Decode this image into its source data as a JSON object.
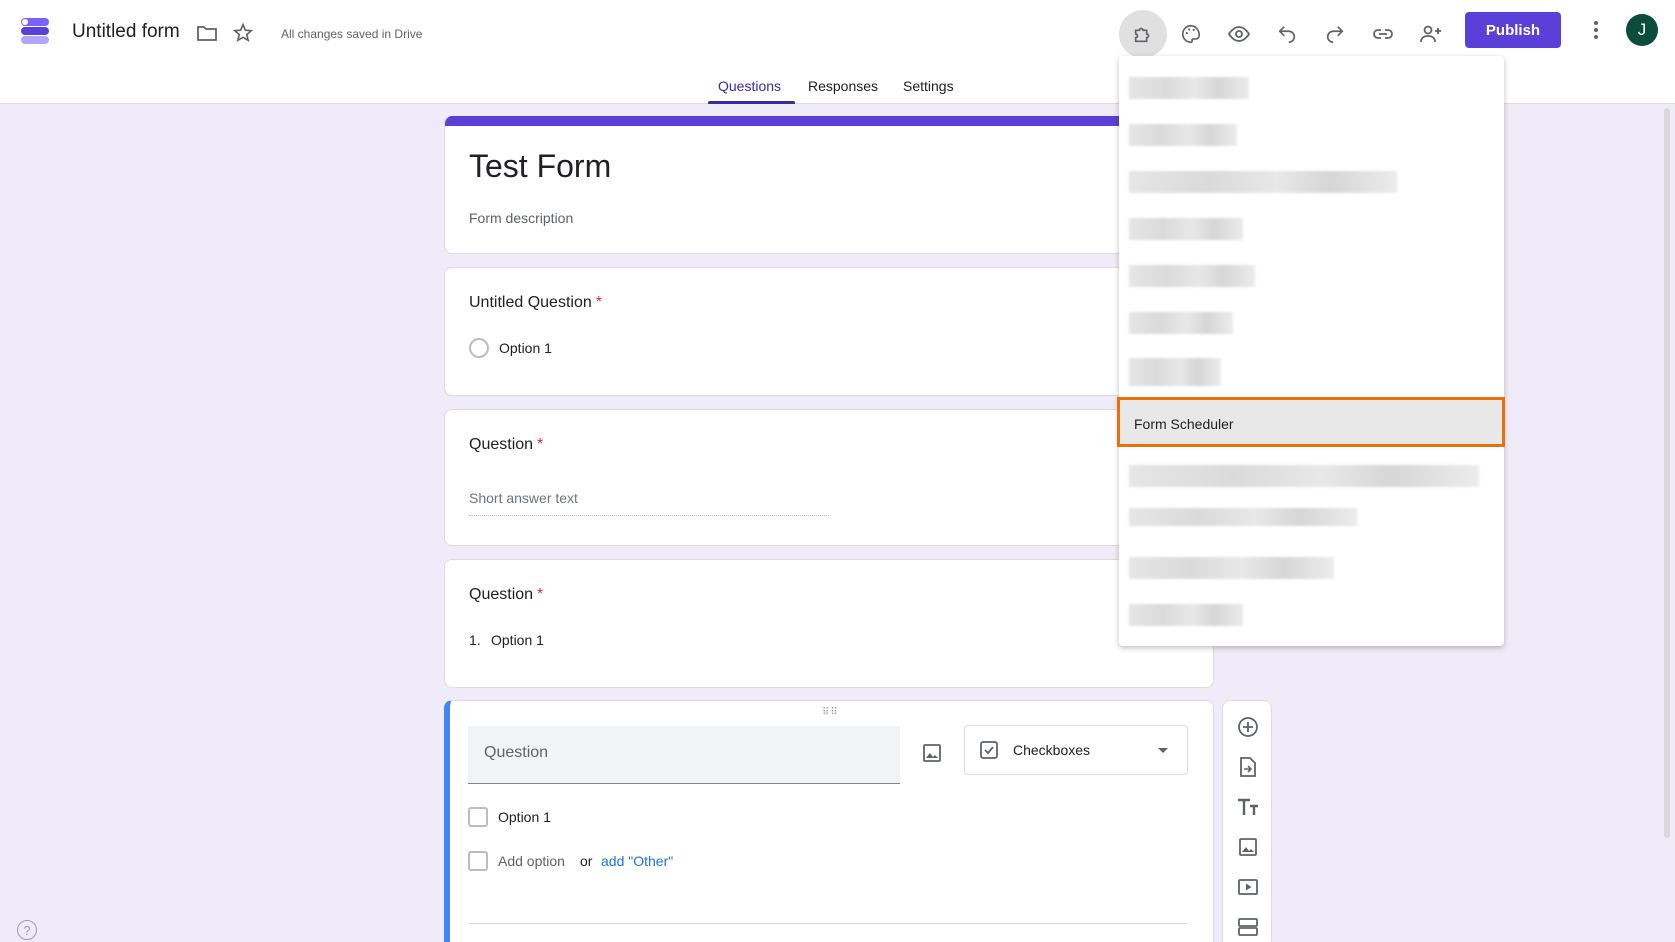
{
  "app": {
    "doc_title": "Untitled form",
    "saved_status": "All changes saved in Drive",
    "publish_label": "Publish",
    "avatar_initial": "J"
  },
  "tabs": [
    {
      "label": "Questions",
      "active": true
    },
    {
      "label": "Responses",
      "active": false
    },
    {
      "label": "Settings",
      "active": false
    }
  ],
  "form": {
    "title": "Test Form",
    "description": "Form description"
  },
  "questions": [
    {
      "title": "Untitled Question",
      "required": true,
      "type": "radio",
      "options": [
        "Option 1"
      ]
    },
    {
      "title": "Question",
      "required": true,
      "type": "short",
      "placeholder": "Short answer text"
    },
    {
      "title": "Question",
      "required": true,
      "type": "list",
      "options": [
        "1.",
        "Option 1"
      ]
    },
    {
      "placeholder": "Question",
      "type": "Checkboxes",
      "options": [
        "Option 1"
      ],
      "add_option": "Add option",
      "or": "or",
      "add_other": "add \"Other\""
    }
  ],
  "required_mark": "*",
  "menu": {
    "highlighted_item": "Form Scheduler"
  },
  "help": "?",
  "colors": {
    "accent": "#5b3fd9",
    "highlight_border": "#e8710a",
    "background": "#f0ebf8",
    "link": "#1a73e8"
  }
}
